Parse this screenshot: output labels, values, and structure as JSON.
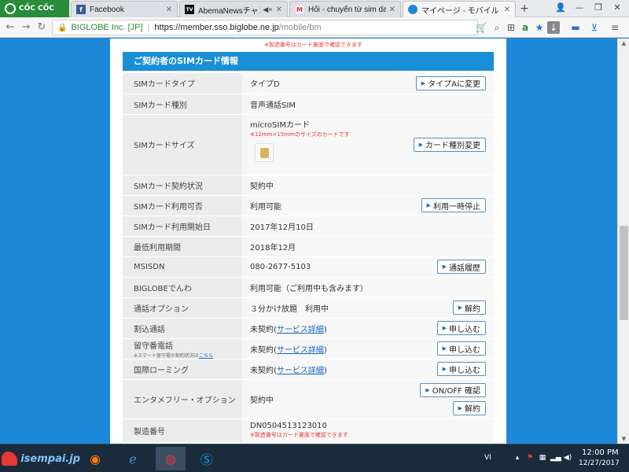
{
  "browser": {
    "logo_text": "CỐC CỐC",
    "tabs": [
      {
        "label": "Facebook",
        "favicon": "facebook-icon",
        "favicon_text": "f"
      },
      {
        "label": "AbemaNewsチャンネ",
        "favicon": "abema-icon",
        "favicon_text": "TV"
      },
      {
        "label": "Hỏi - chuyển từ sim data",
        "favicon": "gmail-icon",
        "favicon_text": "M"
      },
      {
        "label": "マイページ - モバイル",
        "favicon": "biglobe-icon",
        "favicon_text": ""
      }
    ],
    "new_tab": "+",
    "address": {
      "identity": "BIGLOBE Inc. [JP]",
      "host": "https://member.sso.biglobe.ne.jp",
      "path": "/mobile/bm"
    },
    "colors": {
      "secure": "#2a8b3a",
      "page_bg": "#1e88d8",
      "section_header": "#1a8fd6"
    }
  },
  "page": {
    "top_partial_note": "※製造番号はカード裏面で確認できます",
    "section_title": "ご契約者のSIMカード情報",
    "rows": [
      {
        "label": "SIMカードタイプ",
        "value": "タイプD",
        "button": "タイプAに変更"
      },
      {
        "label": "SIMカード種別",
        "value": "音声通話SIM"
      },
      {
        "label": "SIMカードサイズ",
        "value": "microSIMカード",
        "note": "※12mm×15mmのサイズのカードです",
        "button": "カード種別変更"
      },
      {
        "label": "SIMカード契約状況",
        "value": "契約中"
      },
      {
        "label": "SIMカード利用可否",
        "value": "利用可能",
        "button": "利用一時停止"
      },
      {
        "label": "SIMカード利用開始日",
        "value": "2017年12月10日"
      },
      {
        "label": "最低利用期間",
        "value": "2018年12月"
      },
      {
        "label": "MSISDN",
        "value": "080-2677-5103",
        "button": "通話履歴"
      },
      {
        "label": "BIGLOBEでんわ",
        "value": "利用可能（ご利用中も含みます）"
      },
      {
        "label": "通話オプション",
        "value": "３分かけ放題　利用中",
        "button": "解約"
      },
      {
        "label": "割込通話",
        "value": "未契約(",
        "link": "サービス詳細",
        "value_end": ")",
        "button": "申し込む"
      },
      {
        "label": "留守番電話",
        "label_note": "※スマート留守電の契約状況は",
        "label_link": "こちら",
        "value": "未契約(",
        "link": "サービス詳細",
        "value_end": ")",
        "button": "申し込む"
      },
      {
        "label": "国際ローミング",
        "value": "未契約(",
        "link": "サービス詳細",
        "value_end": ")",
        "button": "申し込む"
      },
      {
        "label": "エンタメフリー・オプション",
        "value": "契約中",
        "button": "ON/OFF 確認",
        "button2": "解約"
      },
      {
        "label": "製造番号",
        "value": "DN0504513123010",
        "note": "※製造番号はカード裏面で確認できます"
      }
    ]
  },
  "taskbar": {
    "start_logo_text": "isempai.jp",
    "language": "VI",
    "clock_time": "12:00 PM",
    "clock_date": "12/27/2017"
  }
}
